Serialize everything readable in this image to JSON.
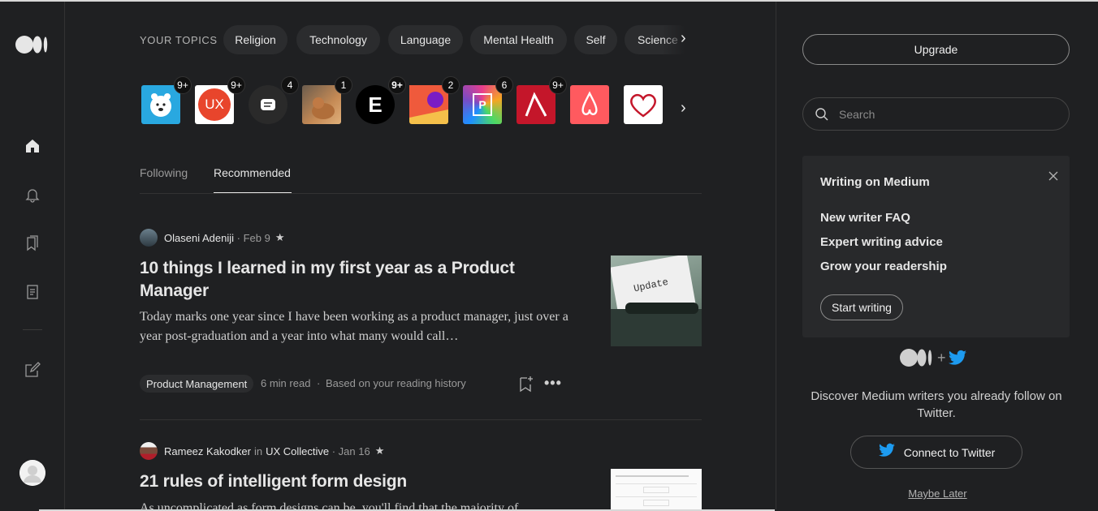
{
  "rail": {
    "icons": [
      "medium-logo-icon",
      "home-icon",
      "bell-icon",
      "bookmarks-icon",
      "stories-icon",
      "write-icon",
      "profile-avatar"
    ]
  },
  "topics": {
    "label": "YOUR TOPICS",
    "pills": [
      "Religion",
      "Technology",
      "Language",
      "Mental Health",
      "Self",
      "Science"
    ]
  },
  "publications": [
    {
      "icon": "polar-bear-icon",
      "badge": "9+",
      "bg": "#29a8e0"
    },
    {
      "icon": "ux-logo-icon",
      "text": "UX",
      "badge": "9+",
      "bg": "#e8452c"
    },
    {
      "icon": "chat-bubble-icon",
      "badge": "4",
      "bg": "#2a2a2a"
    },
    {
      "icon": "cat-photo-icon",
      "badge": "1",
      "bg": "#a0724a"
    },
    {
      "icon": "e-logo-icon",
      "text": "E",
      "badge": "9+",
      "bg": "#000000"
    },
    {
      "icon": "planet-logo-icon",
      "badge": "2",
      "bg": "#ef6a3c"
    },
    {
      "icon": "p-logo-icon",
      "text": "P",
      "badge": "6",
      "bg": "#7a4bc4"
    },
    {
      "icon": "lambda-logo-icon",
      "badge": "9+",
      "bg": "#c4162a"
    },
    {
      "icon": "airbnb-logo-icon",
      "badge": "",
      "bg": "#ff5a5f"
    },
    {
      "icon": "heart-logo-icon",
      "badge": "",
      "bg": "#ffffff"
    }
  ],
  "tabs": [
    "Following",
    "Recommended"
  ],
  "posts": [
    {
      "author": "Olaseni Adeniji",
      "publication": "",
      "date": "Feb 9",
      "star": "★",
      "title": "10 things I learned in my first year as a Product Manager",
      "excerpt": "Today marks one year since I have been working as a product manager, just over a year post-graduation and a year into what many would call…",
      "tag": "Product Management",
      "read_time": "6 min read",
      "reason": "Based on your reading history",
      "thumb_text": "Update"
    },
    {
      "author": "Rameez Kakodker",
      "in": "in",
      "publication": "UX Collective",
      "date": "Jan 16",
      "star": "★",
      "title": "21 rules of intelligent form design",
      "excerpt": "As uncomplicated as form designs can be, you'll find that the majority of"
    }
  ],
  "sidebar": {
    "upgrade": "Upgrade",
    "search_placeholder": "Search",
    "card": {
      "title": "Writing on Medium",
      "links": [
        "New writer FAQ",
        "Expert writing advice",
        "Grow your readership"
      ],
      "cta": "Start writing"
    },
    "plus": "+",
    "discover": "Discover Medium writers you already follow on Twitter.",
    "connect": "Connect to Twitter",
    "maybe": "Maybe Later"
  },
  "colors": {
    "bg": "#1f2022",
    "twitter": "#1d9bf0",
    "pill": "#2b2c2e"
  }
}
